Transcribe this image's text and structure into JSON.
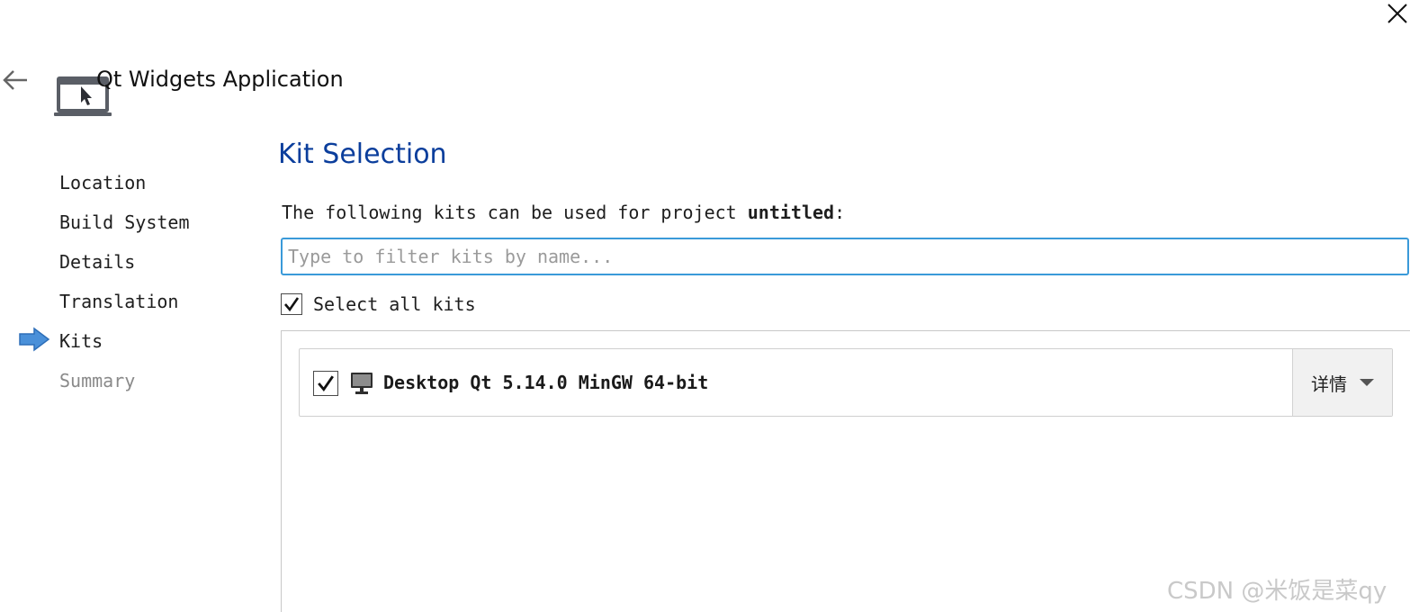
{
  "window": {
    "title": "Qt Widgets Application"
  },
  "steps": [
    {
      "label": "Location",
      "state": "done"
    },
    {
      "label": "Build System",
      "state": "done"
    },
    {
      "label": "Details",
      "state": "done"
    },
    {
      "label": "Translation",
      "state": "done"
    },
    {
      "label": "Kits",
      "state": "current"
    },
    {
      "label": "Summary",
      "state": "pending"
    }
  ],
  "kit_selection": {
    "title": "Kit Selection",
    "intro_prefix": "The following kits can be used for project ",
    "project_name": "untitled",
    "intro_suffix": ":",
    "filter_placeholder": "Type to filter kits by name...",
    "filter_value": "",
    "select_all_label": "Select all kits",
    "select_all_checked": true,
    "kits": [
      {
        "name": "Desktop Qt 5.14.0 MinGW 64-bit",
        "checked": true,
        "details_label": "详情"
      }
    ]
  },
  "watermark": "CSDN @米饭是菜qy",
  "colors": {
    "title_blue": "#0b3e9c",
    "focus_border": "#3a9ad9",
    "step_arrow": "#4a90d9"
  },
  "icons": {
    "close": "close-icon",
    "back": "back-arrow-icon",
    "app": "qt-widgets-app-icon",
    "step_current": "current-step-arrow-icon",
    "kit_type": "desktop-monitor-icon",
    "details_dropdown": "chevron-down-icon"
  }
}
